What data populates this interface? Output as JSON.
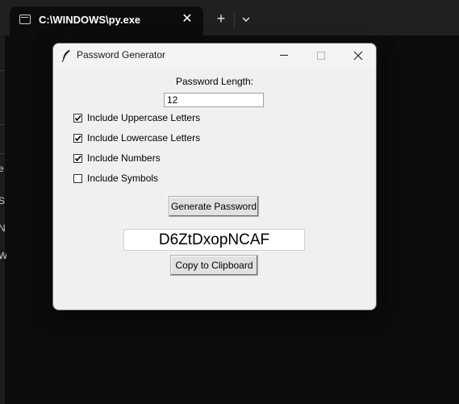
{
  "terminal": {
    "tab_title": "C:\\WINDOWS\\py.exe",
    "tab_close_glyph": "✕",
    "new_tab_glyph": "+",
    "bg_chars": [
      "e",
      "S",
      "N",
      "W"
    ]
  },
  "dialog": {
    "title": "Password Generator",
    "length_label": "Password Length:",
    "length_value": "12",
    "options": [
      {
        "label": "Include Uppercase Letters",
        "checked": true
      },
      {
        "label": "Include Lowercase Letters",
        "checked": true
      },
      {
        "label": "Include Numbers",
        "checked": true
      },
      {
        "label": "Include Symbols",
        "checked": false
      }
    ],
    "generate_label": "Generate Password",
    "password": "D6ZtDxopNCAF",
    "copy_label": "Copy to Clipboard"
  }
}
